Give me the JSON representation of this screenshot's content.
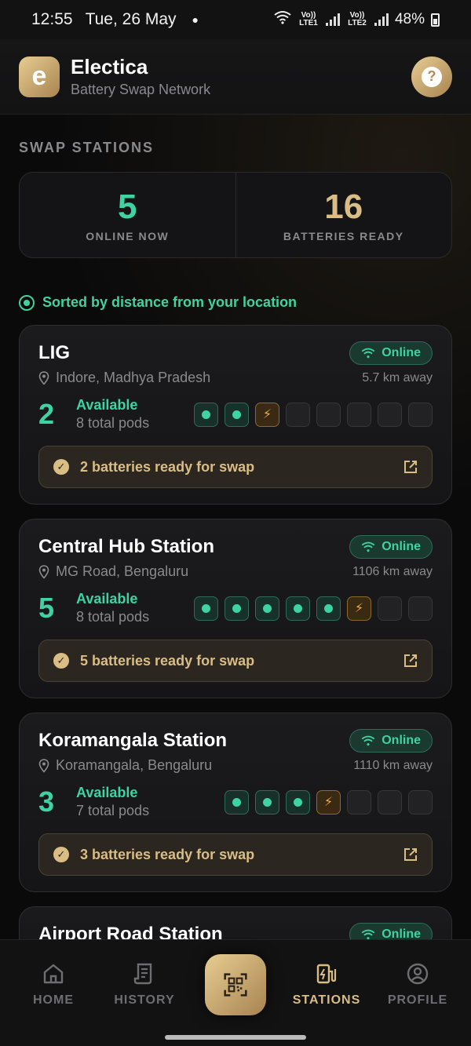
{
  "status_bar": {
    "time": "12:55",
    "date": "Tue, 26 May",
    "sim1_label": "Vo)) LTE1",
    "sim2_label": "Vo)) LTE2",
    "battery": "48%"
  },
  "header": {
    "logo_letter": "e",
    "app_name": "Electica",
    "subtitle": "Battery Swap Network",
    "help_symbol": "?"
  },
  "section_title": "SWAP STATIONS",
  "stats": {
    "online_value": "5",
    "online_label": "ONLINE NOW",
    "batteries_value": "16",
    "batteries_label": "BATTERIES READY"
  },
  "sort_note": "Sorted by distance from your location",
  "stations": [
    {
      "name": "LIG",
      "status": "Online",
      "location": "Indore, Madhya Pradesh",
      "distance": "5.7 km away",
      "available_count": "2",
      "available_label": "Available",
      "total_pods": "8 total pods",
      "pods": [
        "ready",
        "ready",
        "charging",
        "empty",
        "empty",
        "empty",
        "empty",
        "empty"
      ],
      "swap_text": "2 batteries ready for swap"
    },
    {
      "name": "Central Hub Station",
      "status": "Online",
      "location": "MG Road, Bengaluru",
      "distance": "1106 km away",
      "available_count": "5",
      "available_label": "Available",
      "total_pods": "8 total pods",
      "pods": [
        "ready",
        "ready",
        "ready",
        "ready",
        "ready",
        "charging",
        "empty",
        "empty"
      ],
      "swap_text": "5 batteries ready for swap"
    },
    {
      "name": "Koramangala Station",
      "status": "Online",
      "location": "Koramangala, Bengaluru",
      "distance": "1110 km away",
      "available_count": "3",
      "available_label": "Available",
      "total_pods": "7 total pods",
      "pods": [
        "ready",
        "ready",
        "ready",
        "charging",
        "empty",
        "empty",
        "empty"
      ],
      "swap_text": "3 batteries ready for swap"
    },
    {
      "name": "Airport Road Station",
      "status": "Online"
    }
  ],
  "nav": {
    "home": "HOME",
    "history": "HISTORY",
    "stations": "STATIONS",
    "profile": "PROFILE"
  },
  "colors": {
    "accent_green": "#3ed3a1",
    "accent_gold": "#d9bd85",
    "background": "#0a0a0b"
  }
}
